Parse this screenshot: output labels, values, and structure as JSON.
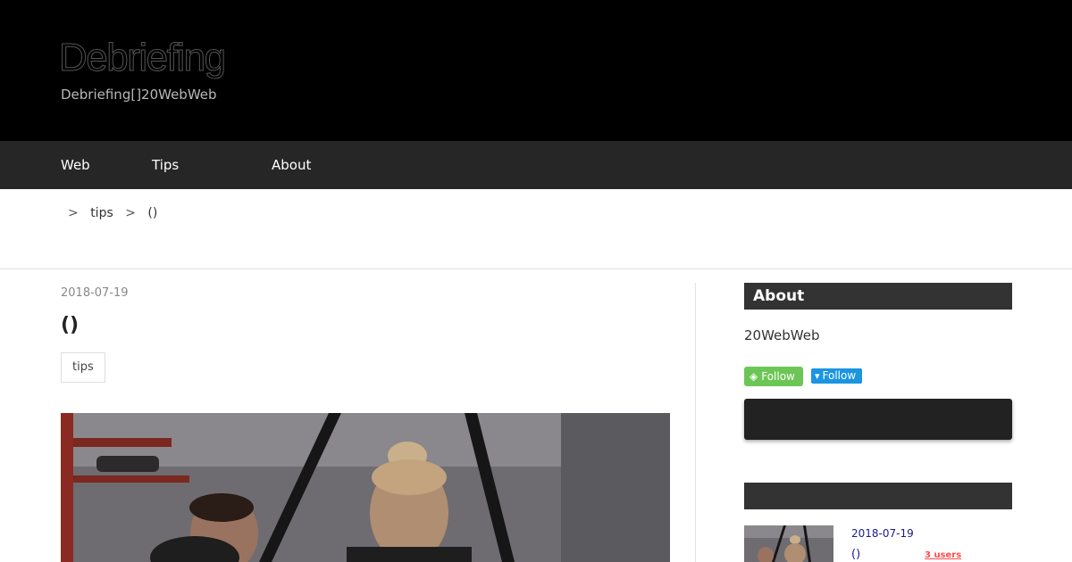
{
  "header": {
    "site_title": "Debriefing",
    "site_description": "Debriefing[]20WebWeb"
  },
  "nav": {
    "items": [
      {
        "label": "Web"
      },
      {
        "label": "Tips"
      },
      {
        "label": "About"
      }
    ]
  },
  "breadcrumb": {
    "separator": ">",
    "category": "tips",
    "current": "()"
  },
  "entry": {
    "date": "2018-07-19",
    "title": "()",
    "category_tag": "tips",
    "image_icon": "workout-photo"
  },
  "sidebar": {
    "about_heading": "About",
    "about_text": "20WebWeb",
    "feedly_label": "Follow",
    "twitter_label": "Follow",
    "recent_heading": "",
    "recent_entries": [
      {
        "date": "2018-07-19",
        "title": "()",
        "hatena_users": "3 users"
      }
    ]
  },
  "colors": {
    "header_bg": "#000000",
    "nav_bg": "#262626",
    "sidebar_heading_bg": "#333333",
    "feedly_green": "#6cc655",
    "twitter_blue": "#1b95e0",
    "link_blue": "#1a1a8c",
    "hatena_red": "#ff4b4b"
  }
}
